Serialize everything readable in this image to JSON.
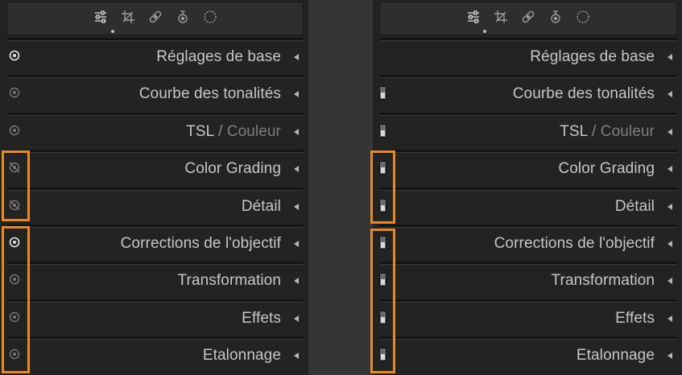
{
  "tools": [
    {
      "name": "edit-sliders-icon"
    },
    {
      "name": "crop-icon"
    },
    {
      "name": "healing-bandage-icon"
    },
    {
      "name": "red-eye-icon"
    },
    {
      "name": "masking-icon"
    }
  ],
  "sections": [
    {
      "label": "Réglages de base",
      "visibility": "on"
    },
    {
      "label": "Courbe des tonalités",
      "visibility": "dim"
    },
    {
      "label": "TSL",
      "label_sep": " / ",
      "label_suffix": "Couleur",
      "visibility": "dim"
    },
    {
      "label": "Color Grading",
      "visibility": "hidden"
    },
    {
      "label": "Détail",
      "visibility": "hidden"
    },
    {
      "label": "Corrections de l'objectif",
      "visibility": "on"
    },
    {
      "label": "Transformation",
      "visibility": "dim"
    },
    {
      "label": "Effets",
      "visibility": "dim"
    },
    {
      "label": "Etalonnage",
      "visibility": "dim"
    }
  ],
  "colors": {
    "highlight": "#e5892c",
    "panel_bg": "#232323",
    "text": "#c6c6c6"
  }
}
